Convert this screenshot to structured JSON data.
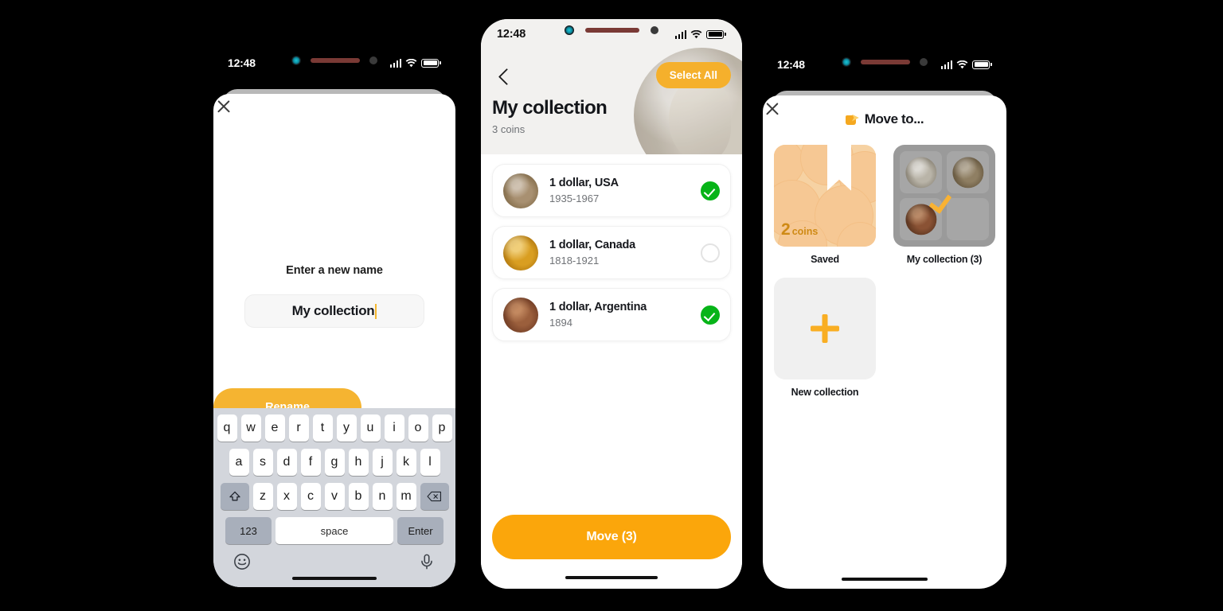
{
  "theme": {
    "accent_orange": "#F5B431",
    "accent_orange_strong": "#FBA60B",
    "green": "#07B418",
    "bg": "#000000"
  },
  "phone1": {
    "status": {
      "time": "12:48",
      "icons": [
        "signal-icon",
        "wifi-icon",
        "battery-icon"
      ]
    },
    "close_label": "",
    "sheet": {
      "label": "Enter a new name",
      "input_value": "My collection",
      "input_placeholder": "Enter a new name",
      "primary_button": "Rename"
    },
    "keyboard": {
      "row1": [
        "q",
        "w",
        "e",
        "r",
        "t",
        "y",
        "u",
        "i",
        "o",
        "p"
      ],
      "row2": [
        "a",
        "s",
        "d",
        "f",
        "g",
        "h",
        "j",
        "k",
        "l"
      ],
      "row3": [
        "z",
        "x",
        "c",
        "v",
        "b",
        "n",
        "m"
      ],
      "shift_key": "shift-icon",
      "backspace_key": "backspace-icon",
      "num_key": "123",
      "space_key": "space",
      "enter_key": "Enter",
      "emoji_key": "emoji-icon",
      "mic_key": "microphone-icon"
    }
  },
  "phone2": {
    "status": {
      "time": "12:48",
      "icons": [
        "signal-icon",
        "wifi-icon",
        "battery-icon"
      ]
    },
    "nav": {
      "back": "back-chevron-icon",
      "select_all": "Select All"
    },
    "header": {
      "title": "My collection",
      "subtitle": "3 coins"
    },
    "coins": [
      {
        "name": "1 dollar, USA",
        "years": "1935-1967",
        "selected": true,
        "thumb": "coin-usa"
      },
      {
        "name": "1 dollar, Canada",
        "years": "1818-1921",
        "selected": false,
        "thumb": "coin-canada"
      },
      {
        "name": "1 dollar, Argentina",
        "years": "1894",
        "selected": true,
        "thumb": "coin-argentina"
      }
    ],
    "cta": "Move (3)"
  },
  "phone3": {
    "status": {
      "time": "12:48",
      "icons": [
        "signal-icon",
        "wifi-icon",
        "battery-icon"
      ]
    },
    "header": {
      "title": "Move to...",
      "icon": "move-folder-icon"
    },
    "tiles": [
      {
        "caption": "Saved",
        "kind": "saved",
        "count_number": "2",
        "count_unit": "coins",
        "selected": false
      },
      {
        "caption": "My collection (3)",
        "kind": "my-collection",
        "selected": true
      },
      {
        "caption": "New collection",
        "kind": "new",
        "selected": false
      }
    ]
  }
}
